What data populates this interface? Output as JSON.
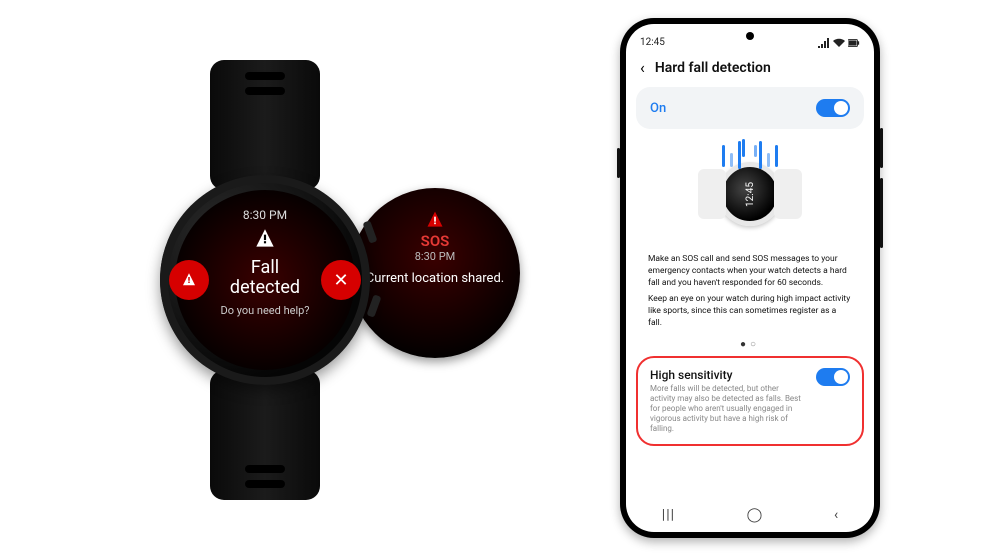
{
  "watch": {
    "face1": {
      "time": "8:30 PM",
      "headline_l1": "Fall",
      "headline_l2": "detected",
      "sub": "Do you need help?",
      "left_btn_icon": "alert-icon",
      "right_btn_glyph": "✕"
    },
    "face2": {
      "sos_label": "SOS",
      "time": "8:30 PM",
      "message": "Current location shared."
    }
  },
  "phone": {
    "status_time": "12:45",
    "appbar": {
      "back_glyph": "‹",
      "title": "Hard fall detection"
    },
    "main_toggle": {
      "label": "On",
      "state": "on"
    },
    "illus_time": "12:45",
    "description_p1": "Make an SOS call and send SOS messages to your emergency contacts when your watch detects a hard fall and you haven't responded for 60 seconds.",
    "description_p2": "Keep an eye on your watch during high impact activity like sports, since this can sometimes register as a fall.",
    "sensitivity": {
      "title": "High sensitivity",
      "body": "More falls will be detected, but other activity may also be detected as falls. Best for people who aren't usually engaged in vigorous activity but have a high risk of falling.",
      "state": "on"
    },
    "nav": {
      "recent": "|||",
      "home": "◯",
      "back": "‹"
    }
  }
}
